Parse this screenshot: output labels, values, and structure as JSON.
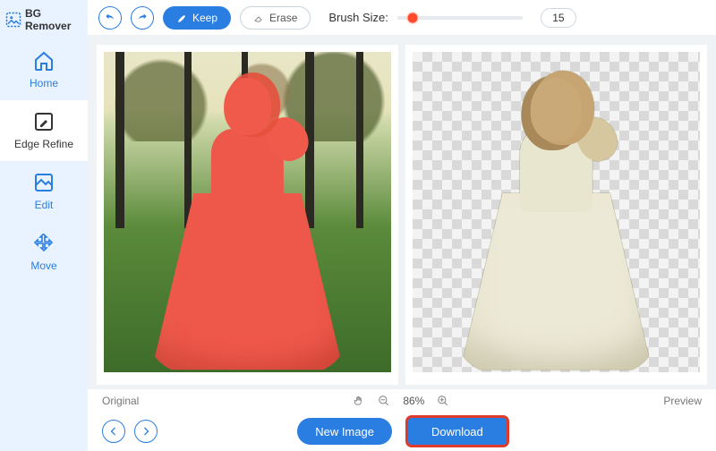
{
  "app": {
    "title": "BG Remover"
  },
  "sidebar": {
    "items": [
      {
        "label": "Home"
      },
      {
        "label": "Edge Refine"
      },
      {
        "label": "Edit"
      },
      {
        "label": "Move"
      }
    ]
  },
  "toolbar": {
    "keep_label": "Keep",
    "erase_label": "Erase",
    "brush_label": "Brush Size:",
    "brush_value": "15",
    "brush_percent": 12
  },
  "footer": {
    "original_label": "Original",
    "zoom_percent": "86%",
    "preview_label": "Preview",
    "new_image_label": "New Image",
    "download_label": "Download"
  }
}
